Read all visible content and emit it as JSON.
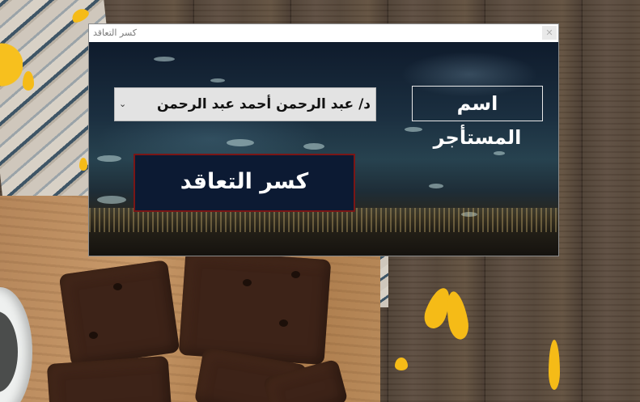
{
  "window": {
    "title": "كسر التعاقد",
    "close_glyph": "✕"
  },
  "form": {
    "tenant_label": "اسم المستأجر",
    "tenant_select": {
      "selected_value": "د/ عبد الرحمن أحمد عبد الرحمن",
      "arrow_glyph": "⌄"
    },
    "break_contract_button": "كسر التعاقد"
  },
  "colors": {
    "button_bg": "#0c1a33",
    "button_border": "#7a1616",
    "label_text": "#ffffff"
  },
  "icons": {
    "close": "close-icon",
    "dropdown": "chevron-down-icon"
  }
}
